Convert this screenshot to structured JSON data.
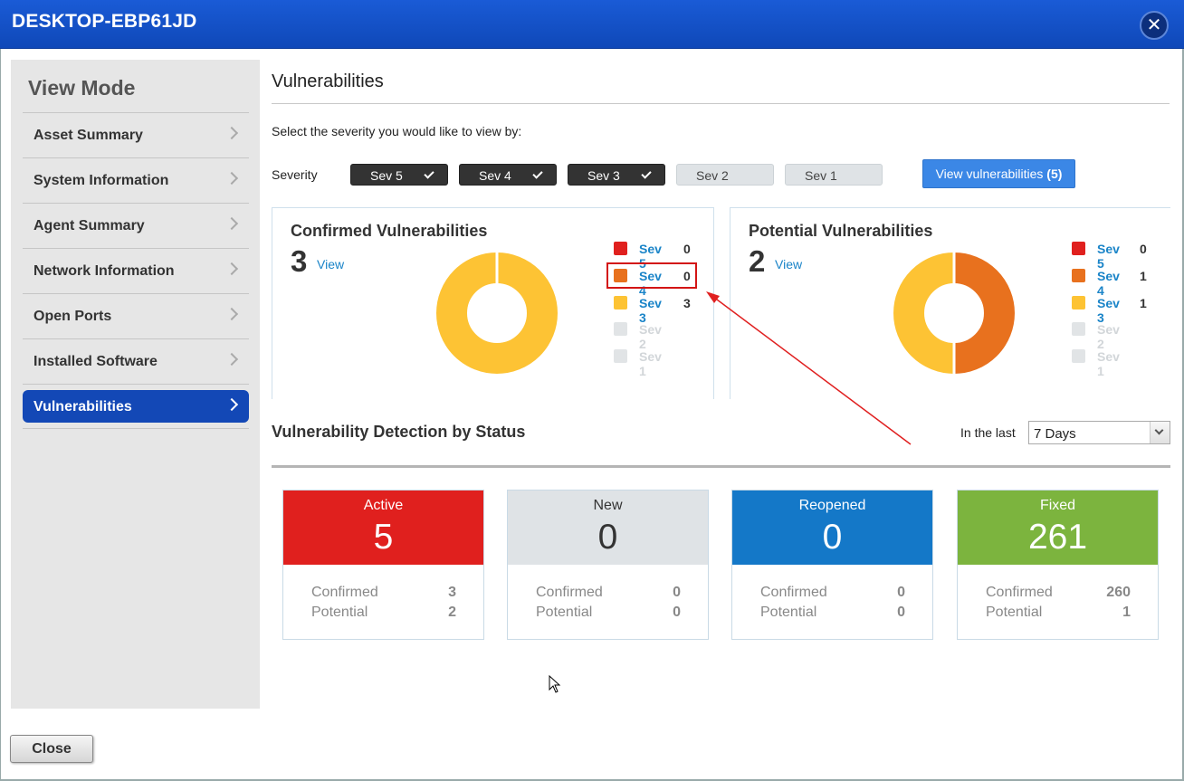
{
  "window": {
    "title": "DESKTOP-EBP61JD",
    "close_icon": "close-icon"
  },
  "sidebar": {
    "title": "View Mode",
    "items": [
      {
        "label": "Asset Summary"
      },
      {
        "label": "System Information"
      },
      {
        "label": "Agent Summary"
      },
      {
        "label": "Network Information"
      },
      {
        "label": "Open Ports"
      },
      {
        "label": "Installed Software"
      },
      {
        "label": "Vulnerabilities",
        "active": true
      }
    ]
  },
  "footer": {
    "close_label": "Close"
  },
  "main": {
    "title": "Vulnerabilities",
    "instruction": "Select the severity you would like to view by:",
    "severity_label": "Severity",
    "severity_buttons": [
      {
        "label": "Sev 5",
        "selected": true
      },
      {
        "label": "Sev 4",
        "selected": true
      },
      {
        "label": "Sev 3",
        "selected": true
      },
      {
        "label": "Sev 2",
        "selected": false
      },
      {
        "label": "Sev 1",
        "selected": false
      }
    ],
    "view_button": {
      "label": "View vulnerabilities",
      "count": "(5)"
    }
  },
  "colors": {
    "sev5": "#e0201e",
    "sev4": "#e8711e",
    "sev3": "#fdc334",
    "sev_dim": "#e1e4e6",
    "active": "#e0201e",
    "new": "#dfe3e6",
    "reopened": "#1478c8",
    "fixed": "#7cb43e"
  },
  "confirmed": {
    "title": "Confirmed Vulnerabilities",
    "count": "3",
    "view_label": "View",
    "legend": [
      {
        "label": "Sev 5",
        "value": "0"
      },
      {
        "label": "Sev 4",
        "value": "0"
      },
      {
        "label": "Sev 3",
        "value": "3"
      },
      {
        "label": "Sev 2",
        "value": ""
      },
      {
        "label": "Sev 1",
        "value": ""
      }
    ],
    "donut": [
      {
        "sev": "Sev 3",
        "value": 3
      }
    ]
  },
  "potential": {
    "title": "Potential Vulnerabilities",
    "count": "2",
    "view_label": "View",
    "legend": [
      {
        "label": "Sev 5",
        "value": "0"
      },
      {
        "label": "Sev 4",
        "value": "1"
      },
      {
        "label": "Sev 3",
        "value": "1"
      },
      {
        "label": "Sev 2",
        "value": ""
      },
      {
        "label": "Sev 1",
        "value": ""
      }
    ],
    "donut": [
      {
        "sev": "Sev 4",
        "value": 1
      },
      {
        "sev": "Sev 3",
        "value": 1
      }
    ]
  },
  "detection": {
    "title": "Vulnerability Detection by Status",
    "in_the_last_label": "In the last",
    "period": "7 Days",
    "cards": [
      {
        "label": "Active",
        "value": "5",
        "confirmed_label": "Confirmed",
        "confirmed": "3",
        "potential_label": "Potential",
        "potential": "2"
      },
      {
        "label": "New",
        "value": "0",
        "confirmed_label": "Confirmed",
        "confirmed": "0",
        "potential_label": "Potential",
        "potential": "0"
      },
      {
        "label": "Reopened",
        "value": "0",
        "confirmed_label": "Confirmed",
        "confirmed": "0",
        "potential_label": "Potential",
        "potential": "0"
      },
      {
        "label": "Fixed",
        "value": "261",
        "confirmed_label": "Confirmed",
        "confirmed": "260",
        "potential_label": "Potential",
        "potential": "1"
      }
    ]
  }
}
